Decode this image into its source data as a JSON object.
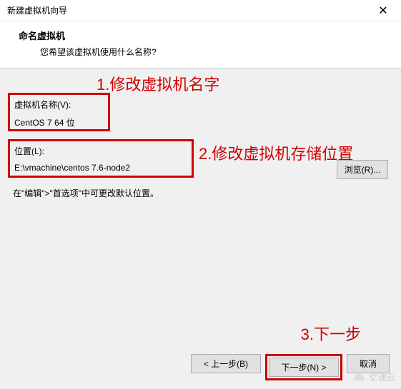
{
  "window": {
    "title": "新建虚拟机向导"
  },
  "header": {
    "title": "命名虚拟机",
    "subtitle": "您希望该虚拟机使用什么名称?"
  },
  "annotations": {
    "a1": "1.修改虚拟机名字",
    "a2": "2.修改虚拟机存储位置",
    "a3": "3.下一步"
  },
  "fields": {
    "vm_name_label": "虚拟机名称(V):",
    "vm_name_value": "CentOS 7 64 位",
    "location_label": "位置(L):",
    "location_value": "E:\\vmachine\\centos 7.6-node2",
    "browse_label": "浏览(R)..."
  },
  "hint": "在\"编辑\">\"首选项\"中可更改默认位置。",
  "buttons": {
    "back": "< 上一步(B)",
    "next": "下一步(N) >",
    "cancel": "取消"
  },
  "watermark": "亿速云"
}
